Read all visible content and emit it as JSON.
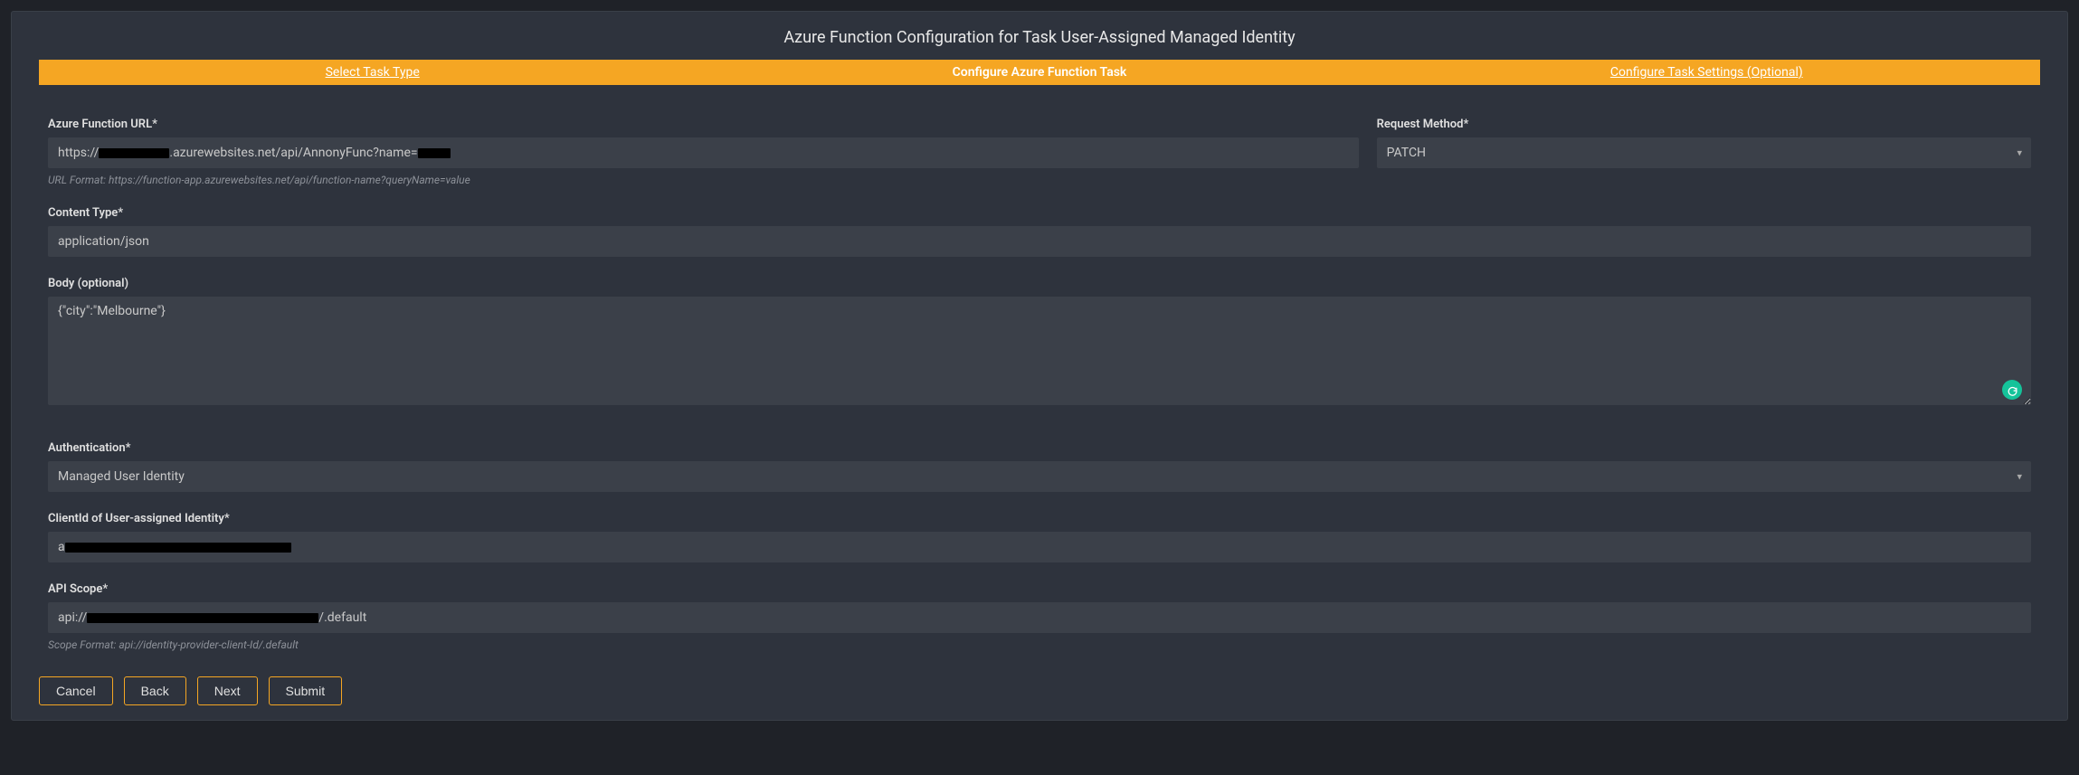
{
  "header": {
    "title": "Azure Function Configuration for Task User-Assigned Managed Identity"
  },
  "steps": [
    {
      "label": "Select Task Type",
      "active": false
    },
    {
      "label": "Configure Azure Function Task",
      "active": true
    },
    {
      "label": "Configure Task Settings (Optional)",
      "active": false
    }
  ],
  "fields": {
    "url": {
      "label": "Azure Function URL*",
      "prefix": "https://",
      "mid": ".azurewebsites.net/api/AnnonyFunc?name=",
      "hint": "URL Format: https://function-app.azurewebsites.net/api/function-name?queryName=value"
    },
    "method": {
      "label": "Request Method*",
      "value": "PATCH"
    },
    "contentType": {
      "label": "Content Type*",
      "value": "application/json"
    },
    "body": {
      "label": "Body (optional)",
      "value": "{\"city\":\"Melbourne\"}"
    },
    "auth": {
      "label": "Authentication*",
      "value": "Managed User Identity"
    },
    "clientId": {
      "label": "ClientId of User-assigned Identity*",
      "prefix": "a"
    },
    "scope": {
      "label": "API Scope*",
      "prefix": "api://",
      "suffix": "/.default",
      "hint": "Scope Format: api://identity-provider-client-Id/.default"
    }
  },
  "buttons": {
    "cancel": "Cancel",
    "back": "Back",
    "next": "Next",
    "submit": "Submit"
  },
  "icons": {
    "grammarly": "G"
  }
}
